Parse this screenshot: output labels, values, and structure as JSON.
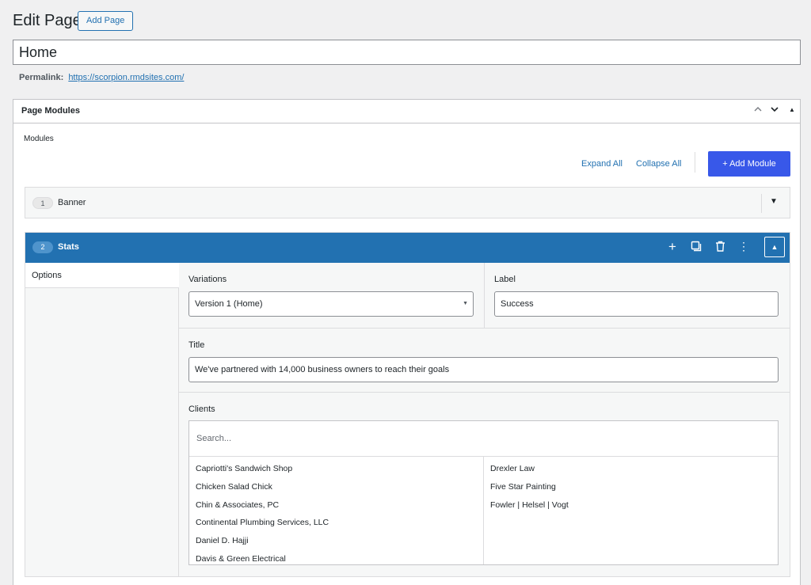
{
  "header": {
    "title": "Edit Page",
    "add_page_label": "Add Page",
    "page_title_value": "Home",
    "permalink_label": "Permalink:",
    "permalink_url": "https://scorpion.rmdsites.com/"
  },
  "postbox": {
    "title": "Page Modules",
    "controls": {
      "up": "^",
      "down": "v",
      "toggle": "▲"
    }
  },
  "modules_section": {
    "label": "Modules",
    "expand_all": "Expand All",
    "collapse_all": "Collapse All",
    "add_module": "+ Add Module"
  },
  "modules": [
    {
      "number": "1",
      "name": "Banner",
      "toggle": "▼"
    },
    {
      "number": "2",
      "name": "Stats",
      "collapse": "▲"
    }
  ],
  "stats_actions": {
    "add": "+",
    "duplicate": "⧉",
    "delete": "🗑",
    "more": "⋮"
  },
  "tabs": [
    {
      "label": "Options"
    }
  ],
  "fields": {
    "variations_label": "Variations",
    "variations_value": "Version 1 (Home)",
    "variations_arrow": "▼",
    "label_label": "Label",
    "label_value": "Success",
    "title_label": "Title",
    "title_value": "We've partnered with 14,000 business owners to reach their goals",
    "clients_label": "Clients",
    "clients_search_placeholder": "Search..."
  },
  "clients": {
    "left": [
      "Capriotti's Sandwich Shop",
      "Chicken Salad Chick",
      "Chin & Associates, PC",
      "Continental Plumbing Services, LLC",
      "Daniel D. Hajji",
      "Davis & Green Electrical"
    ],
    "right": [
      "Drexler Law",
      "Five Star Painting",
      "Fowler | Helsel | Vogt"
    ]
  },
  "colors": {
    "accent": "#2271b1",
    "add_module_bg": "#3858e9",
    "background": "#f0f0f1"
  }
}
